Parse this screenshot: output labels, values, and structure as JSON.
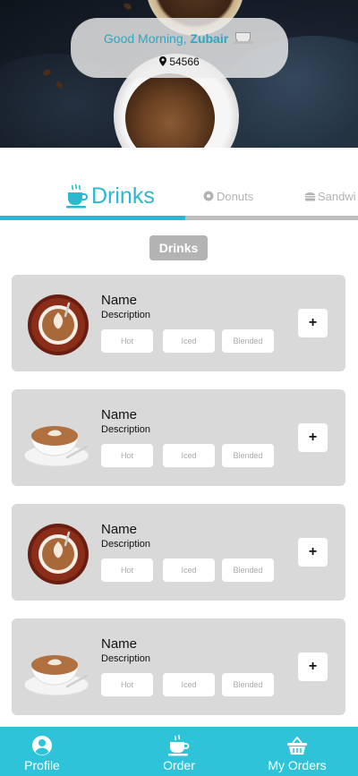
{
  "header": {
    "greeting_prefix": "Good Morning, ",
    "user_name": "Zubair",
    "zip_code": "54566"
  },
  "tabs": [
    {
      "label": "Drinks",
      "active": true,
      "icon": "coffee-cup-icon"
    },
    {
      "label": "Donuts",
      "active": false,
      "icon": "donut-icon"
    },
    {
      "label": "Sandwi",
      "active": false,
      "icon": "sandwich-icon"
    }
  ],
  "section_title": "Drinks",
  "products": [
    {
      "name": "Name",
      "description": "Description",
      "image": "latte-top-view",
      "options": [
        "Hot",
        "Iced",
        "Blended"
      ],
      "add_label": "+"
    },
    {
      "name": "Name",
      "description": "Description",
      "image": "latte-side-view",
      "options": [
        "Hot",
        "Iced",
        "Blended"
      ],
      "add_label": "+"
    },
    {
      "name": "Name",
      "description": "Description",
      "image": "latte-top-view",
      "options": [
        "Hot",
        "Iced",
        "Blended"
      ],
      "add_label": "+"
    },
    {
      "name": "Name",
      "description": "Description",
      "image": "latte-side-view",
      "options": [
        "Hot",
        "Iced",
        "Blended"
      ],
      "add_label": "+"
    }
  ],
  "bottom_nav": [
    {
      "label": "Profile",
      "icon": "user-circle-icon"
    },
    {
      "label": "Order",
      "icon": "coffee-cup-icon"
    },
    {
      "label": "My Orders",
      "icon": "basket-icon"
    }
  ],
  "colors": {
    "accent": "#2ab8d0",
    "nav_bg": "#2ec3d8",
    "card_bg": "#d9d9d9",
    "chip_bg": "#b3b3b3"
  }
}
